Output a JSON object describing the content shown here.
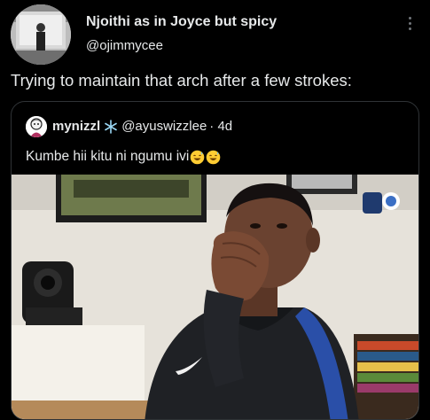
{
  "post": {
    "author_name": "Njoithi as in Joyce but spicy",
    "author_handle": "@ojimmycee",
    "text": "Trying to maintain that arch after a few strokes:"
  },
  "quote": {
    "author_name": "mynizzl",
    "badge_icon": "snowflake-icon",
    "author_handle": "@ayuswizzlee",
    "time": "· 4d",
    "text": "Kumbe hii kitu ni ngumu ivi",
    "emoji": [
      "grinning-sweat-emoji",
      "grinning-sweat-emoji"
    ]
  },
  "colors": {
    "background": "#000000",
    "text": "#e7e9ea",
    "border": "#2f3336",
    "muted": "#71767b"
  }
}
